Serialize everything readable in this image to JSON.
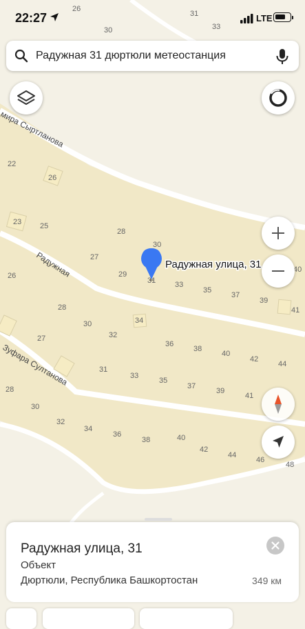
{
  "status_bar": {
    "time": "22:27",
    "network": "LTE",
    "battery_level": 0.75
  },
  "search": {
    "query": "Радужная 31 дюртюли метеостанция",
    "icon": "search-icon",
    "mic_icon": "microphone-icon"
  },
  "map": {
    "marker_label": "Радужная улица, 31",
    "marker_color": "#3a78f2",
    "street_labels": [
      "Радужная",
      "Зуфара Султанова",
      "мира Сыртланова"
    ],
    "house_numbers": [
      "26",
      "30",
      "31",
      "33",
      "22",
      "26",
      "23",
      "25",
      "28",
      "30",
      "27",
      "29",
      "31",
      "33",
      "35",
      "37",
      "39",
      "40",
      "41",
      "26",
      "28",
      "30",
      "34",
      "32",
      "27",
      "36",
      "38",
      "40",
      "42",
      "44",
      "31",
      "33",
      "35",
      "37",
      "39",
      "41",
      "28",
      "30",
      "32",
      "34",
      "36",
      "38",
      "40",
      "42",
      "44",
      "46",
      "48"
    ]
  },
  "controls": {
    "layers_icon": "layers-icon",
    "profile_icon": "profile-ring-icon",
    "zoom_in_icon": "plus-icon",
    "zoom_out_icon": "minus-icon",
    "compass_icon": "compass-icon",
    "location_icon": "navigation-arrow-icon"
  },
  "place_card": {
    "title": "Радужная улица, 31",
    "type": "Объект",
    "address": "Дюртюли, Республика Башкортостан",
    "distance": "349 км",
    "close_icon": "close-icon"
  }
}
